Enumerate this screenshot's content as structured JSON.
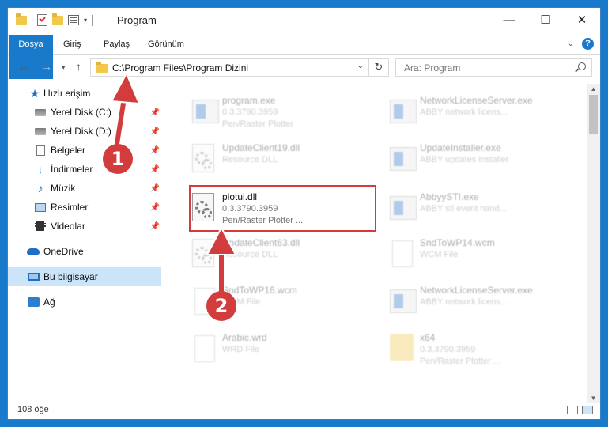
{
  "window": {
    "title": "Program"
  },
  "ribbon": {
    "tabs": [
      "Dosya",
      "Giriş",
      "Paylaş",
      "Görünüm"
    ]
  },
  "navbar": {
    "address": "C:\\Program Files\\Program Dizini",
    "search_placeholder": "Ara: Program"
  },
  "nav_pane": {
    "items": [
      {
        "label": "Hızlı erişim",
        "icon": "star-icon"
      },
      {
        "label": "Yerel Disk (C:)",
        "icon": "drive-icon",
        "pinned": true
      },
      {
        "label": "Yerel Disk (D:)",
        "icon": "drive-icon",
        "pinned": true
      },
      {
        "label": "Belgeler",
        "icon": "document-icon",
        "pinned": true
      },
      {
        "label": "İndirmeler",
        "icon": "download-icon",
        "pinned": true
      },
      {
        "label": "Müzik",
        "icon": "music-icon",
        "pinned": true
      },
      {
        "label": "Resimler",
        "icon": "pictures-icon",
        "pinned": true
      },
      {
        "label": "Videolar",
        "icon": "videos-icon",
        "pinned": true
      },
      {
        "label": "OneDrive",
        "icon": "onedrive-icon"
      },
      {
        "label": "Bu bilgisayar",
        "icon": "computer-icon",
        "selected": true
      },
      {
        "label": "Ağ",
        "icon": "network-icon"
      }
    ]
  },
  "files": [
    {
      "name": "program.exe",
      "line2": "0.3.3790.3959",
      "line3": "Pen/Raster Plotter",
      "icon": "exe-icon",
      "col": 0,
      "row": 0
    },
    {
      "name": "UpdateClient19.dll",
      "line2": "Resource DLL",
      "line3": "",
      "icon": "dll-icon",
      "col": 0,
      "row": 1
    },
    {
      "name": "plotui.dll",
      "line2": "0.3.3790.3959",
      "line3": "Pen/Raster Plotter ...",
      "icon": "dll-icon",
      "col": 0,
      "row": 2,
      "highlighted": true
    },
    {
      "name": "UpdateClient63.dll",
      "line2": "Resource DLL",
      "line3": "",
      "icon": "dll-icon",
      "col": 0,
      "row": 3
    },
    {
      "name": "SndToWP16.wcm",
      "line2": "WCM File",
      "line3": "",
      "icon": "file-icon",
      "col": 0,
      "row": 4
    },
    {
      "name": "Arabic.wrd",
      "line2": "WRD File",
      "line3": "",
      "icon": "file-icon",
      "col": 0,
      "row": 5
    },
    {
      "name": "NetworkLicenseServer.exe",
      "line2": "ABBY network licens...",
      "line3": "",
      "icon": "exe-icon",
      "col": 1,
      "row": 0
    },
    {
      "name": "UpdateInstaller.exe",
      "line2": "ABBY updates installer",
      "line3": "",
      "icon": "exe-icon",
      "col": 1,
      "row": 1
    },
    {
      "name": "AbbyySTI.exe",
      "line2": "ABBY sti event hand...",
      "line3": "",
      "icon": "exe-icon",
      "col": 1,
      "row": 2
    },
    {
      "name": "SndToWP14.wcm",
      "line2": "WCM File",
      "line3": "",
      "icon": "file-icon",
      "col": 1,
      "row": 3
    },
    {
      "name": "NetworkLicenseServer.exe",
      "line2": "ABBY network licens...",
      "line3": "",
      "icon": "exe-icon",
      "col": 1,
      "row": 4
    },
    {
      "name": "x64",
      "line2": "0.3.3790.3959",
      "line3": "Pen/Raster Plotter ...",
      "icon": "folder-icon",
      "col": 1,
      "row": 5
    }
  ],
  "status": {
    "item_count": "108 öğe"
  },
  "annotations": {
    "step1": "1",
    "step2": "2"
  },
  "colors": {
    "accent": "#1979ca",
    "highlight": "#d23c3c",
    "selection": "#cce4f7"
  }
}
